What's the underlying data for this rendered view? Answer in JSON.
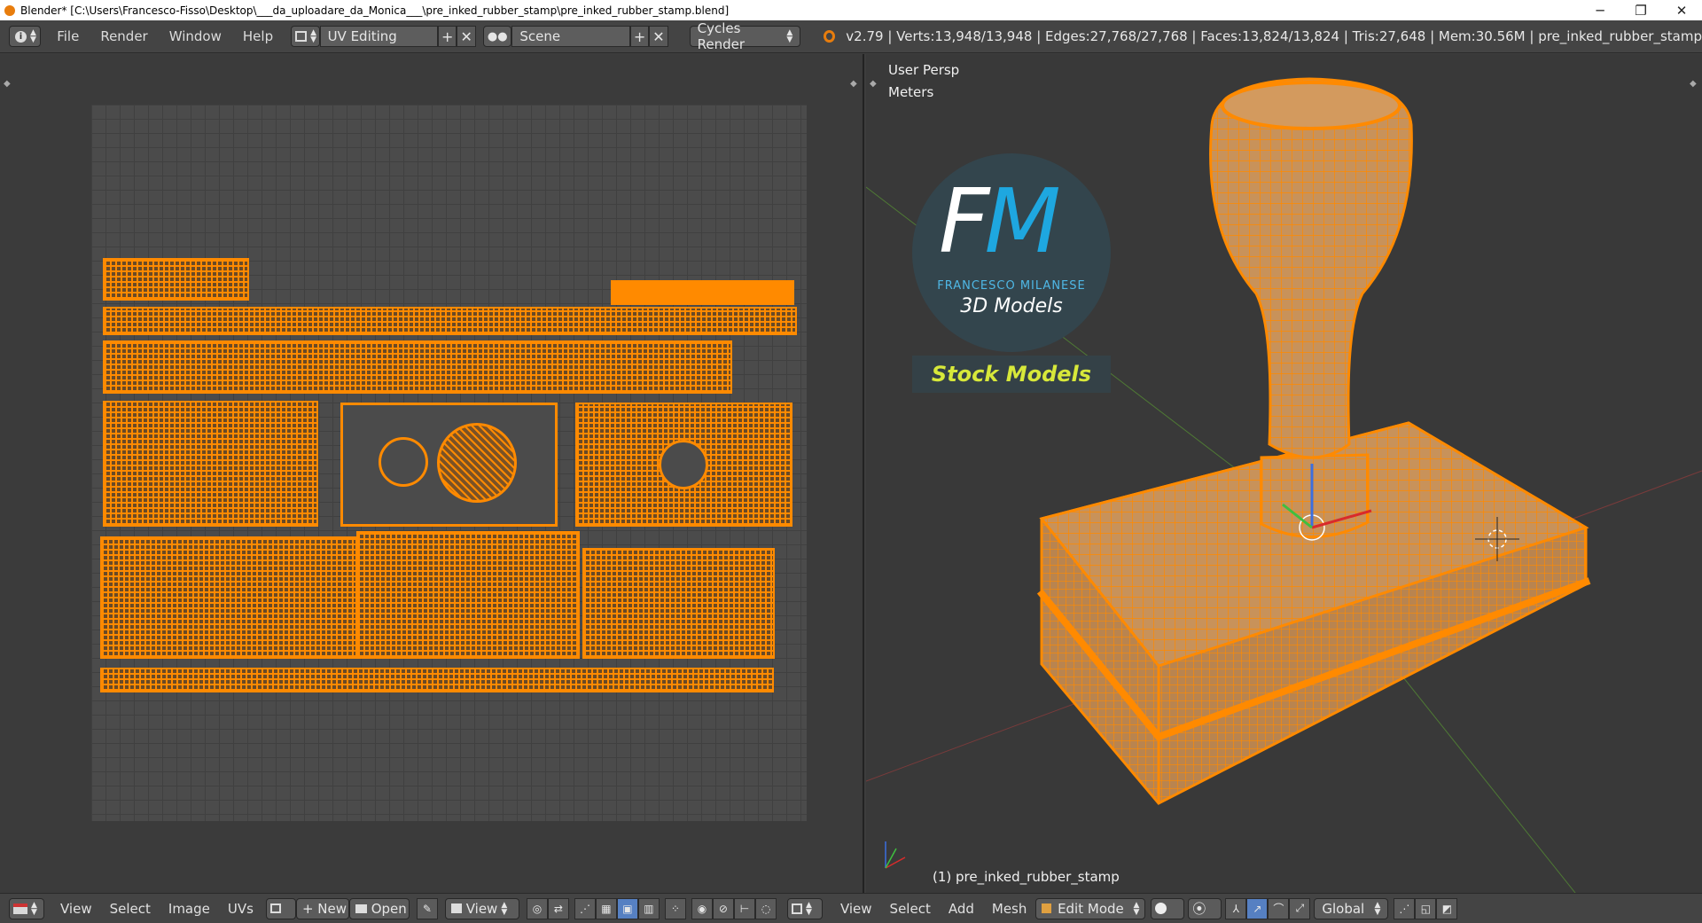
{
  "window": {
    "title": "Blender* [C:\\Users\\Francesco-Fisso\\Desktop\\___da_uploadare_da_Monica___\\pre_inked_rubber_stamp\\pre_inked_rubber_stamp.blend]",
    "minimize": "─",
    "maximize": "❐",
    "close": "✕"
  },
  "topbar": {
    "info_icon": "i",
    "menus": [
      "File",
      "Render",
      "Window",
      "Help"
    ],
    "layout": "UV Editing",
    "scene": "Scene",
    "engine": "Cycles Render",
    "stats": "v2.79 | Verts:13,948/13,948 | Edges:27,768/27,768 | Faces:13,824/13,824 | Tris:27,648 | Mem:30.56M | pre_inked_rubber_stamp"
  },
  "viewport": {
    "persp": "User Persp",
    "units": "Meters",
    "object": "(1) pre_inked_rubber_stamp",
    "logo_letters": "FM",
    "logo_name": "FRANCESCO MILANESE",
    "logo_subtitle": "3D Models",
    "banner": "Stock Models"
  },
  "uv_bottom": {
    "menus": [
      "View",
      "Select",
      "Image",
      "UVs"
    ],
    "new_label": "New",
    "open_label": "Open",
    "view_label": "View"
  },
  "vp_bottom": {
    "menus": [
      "View",
      "Select",
      "Add",
      "Mesh"
    ],
    "mode": "Edit Mode",
    "orientation": "Global"
  },
  "colors": {
    "accent": "#ff8a00",
    "selected_button": "#5680c2",
    "logo_blue": "#1ea7e0",
    "banner_text": "#d7e83a"
  }
}
